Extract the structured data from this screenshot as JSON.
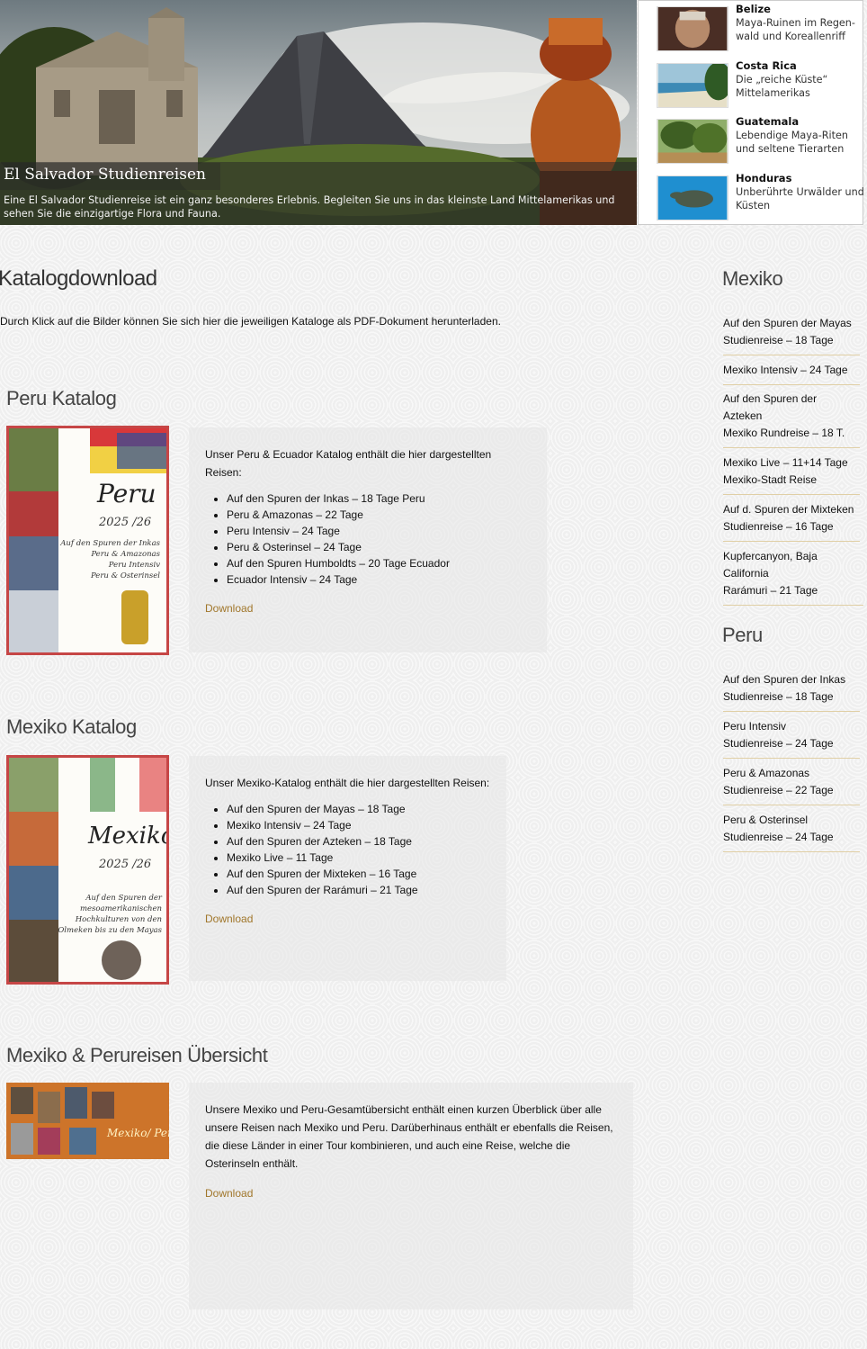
{
  "hero": {
    "title": "El Salvador Studienreisen",
    "description": "Eine El Salvador Studienreise ist ein ganz besonderes Erlebnis. Begleiten Sie uns in das kleinste Land Mittelamerikas und sehen Sie die einzigartige Flora und Fauna."
  },
  "teasers": [
    {
      "name": "Belize",
      "desc": "Maya-Ruinen im Regen-wald und Koreallenriff"
    },
    {
      "name": "Costa Rica",
      "desc": "Die „reiche Küste“ Mittelamerikas"
    },
    {
      "name": "Guatemala",
      "desc": "Lebendige Maya-Riten und seltene Tierarten"
    },
    {
      "name": "Honduras",
      "desc": "Unberührte Urwälder und Küsten"
    }
  ],
  "main": {
    "title": "Katalogdownload",
    "intro": "Durch Klick auf die Bilder können Sie sich hier die jeweiligen Kataloge als PDF-Dokument herunterladen."
  },
  "sections": [
    {
      "title": "Peru Katalog",
      "intro": "Unser Peru & Ecuador Katalog enthält die hier dargestellten Reisen:",
      "items": [
        "Auf den Spuren der Inkas – 18 Tage Peru",
        "Peru & Amazonas – 22 Tage",
        "Peru Intensiv – 24 Tage",
        "Peru & Osterinsel – 24 Tage",
        "Auf den Spuren Humboldts – 20 Tage Ecuador",
        "Ecuador Intensiv – 24 Tage"
      ],
      "download": "Download",
      "cover": {
        "heading": "Peru",
        "year": "2025 /26",
        "lines": [
          "Auf den Spuren der Inkas",
          "Peru & Amazonas",
          "Peru Intensiv",
          "Peru & Osterinsel"
        ]
      }
    },
    {
      "title": "Mexiko Katalog",
      "intro": "Unser Mexiko-Katalog enthält die hier dargestellten Reisen:",
      "items": [
        "Auf den Spuren der Mayas – 18 Tage",
        "Mexiko Intensiv – 24 Tage",
        "Auf den Spuren der Azteken – 18 Tage",
        "Mexiko Live – 11 Tage",
        "Auf den Spuren der Mixteken – 16 Tage",
        "Auf den Spuren der Rarámuri – 21 Tage"
      ],
      "download": "Download",
      "cover": {
        "heading": "Mexiko",
        "year": "2025 /26",
        "lines": [
          "Auf den Spuren der",
          "mesoamerikanischen",
          "Hochkulturen von den",
          "Olmeken bis zu den Mayas"
        ]
      }
    },
    {
      "title": "Mexiko & Perureisen Übersicht",
      "text": "Unsere Mexiko und Peru-Gesamtübersicht enthält einen kurzen Überblick über alle unsere Reisen nach Mexiko und Peru. Darüberhinaus enthält er ebenfalls die Reisen, die diese Länder in einer Tour kombinieren, und auch eine Reise, welche die Osterinseln enthält.",
      "download": "Download",
      "cover": {
        "heading": "Mexiko/ Peru"
      }
    }
  ],
  "sidebar": {
    "mexiko_title": "Mexiko",
    "mexiko": [
      [
        "Auf den Spuren der Mayas",
        "Studienreise – 18 Tage"
      ],
      [
        "Mexiko Intensiv – 24 Tage"
      ],
      [
        "Auf den Spuren der",
        "Azteken",
        "Mexiko Rundreise – 18 T."
      ],
      [
        "Mexiko Live – 11+14 Tage",
        "Mexiko-Stadt Reise"
      ],
      [
        "Auf d. Spuren der Mixteken",
        "Studienreise – 16 Tage"
      ],
      [
        "Kupfercanyon, Baja California",
        "Rarámuri – 21 Tage"
      ]
    ],
    "peru_title": "Peru",
    "peru": [
      [
        "Auf den Spuren der Inkas",
        "Studienreise – 18 Tage"
      ],
      [
        "Peru Intensiv",
        "Studienreise – 24 Tage"
      ],
      [
        "Peru & Amazonas",
        "Studienreise – 22 Tage"
      ],
      [
        "Peru & Osterinsel",
        "Studienreise – 24 Tage"
      ]
    ]
  }
}
